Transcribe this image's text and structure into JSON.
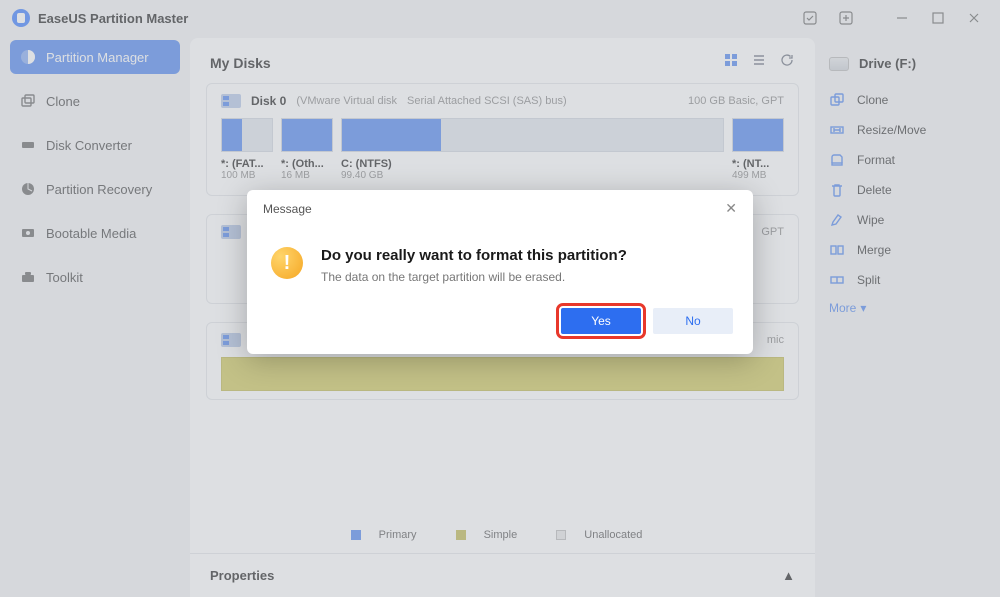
{
  "titlebar": {
    "title": "EaseUS Partition Master"
  },
  "sidebar": {
    "items": [
      {
        "label": "Partition Manager"
      },
      {
        "label": "Clone"
      },
      {
        "label": "Disk Converter"
      },
      {
        "label": "Partition Recovery"
      },
      {
        "label": "Bootable Media"
      },
      {
        "label": "Toolkit"
      }
    ]
  },
  "main": {
    "heading": "My Disks"
  },
  "disk0": {
    "name": "Disk 0",
    "vendor": "(VMware   Virtual disk",
    "bus": "Serial Attached SCSI (SAS) bus)",
    "meta": "100 GB Basic, GPT",
    "parts": [
      {
        "label": "*: (FAT...",
        "size": "100 MB"
      },
      {
        "label": "*: (Oth...",
        "size": "16 MB"
      },
      {
        "label": "C: (NTFS)",
        "size": "99.40 GB"
      },
      {
        "label": "*: (NT...",
        "size": "499 MB"
      }
    ]
  },
  "legend": {
    "primary": "Primary",
    "simple": "Simple",
    "unallocated": "Unallocated"
  },
  "properties": {
    "label": "Properties"
  },
  "rightpanel": {
    "drive": "Drive (F:)",
    "actions": [
      {
        "label": "Clone"
      },
      {
        "label": "Resize/Move"
      },
      {
        "label": "Format"
      },
      {
        "label": "Delete"
      },
      {
        "label": "Wipe"
      },
      {
        "label": "Merge"
      },
      {
        "label": "Split"
      }
    ],
    "more": "More"
  },
  "modal": {
    "title": "Message",
    "heading": "Do you really want to format this partition?",
    "body": "The data on the target partition will be erased.",
    "yes": "Yes",
    "no": "No"
  },
  "hidden_meta1": "GPT",
  "hidden_meta2": "mic"
}
